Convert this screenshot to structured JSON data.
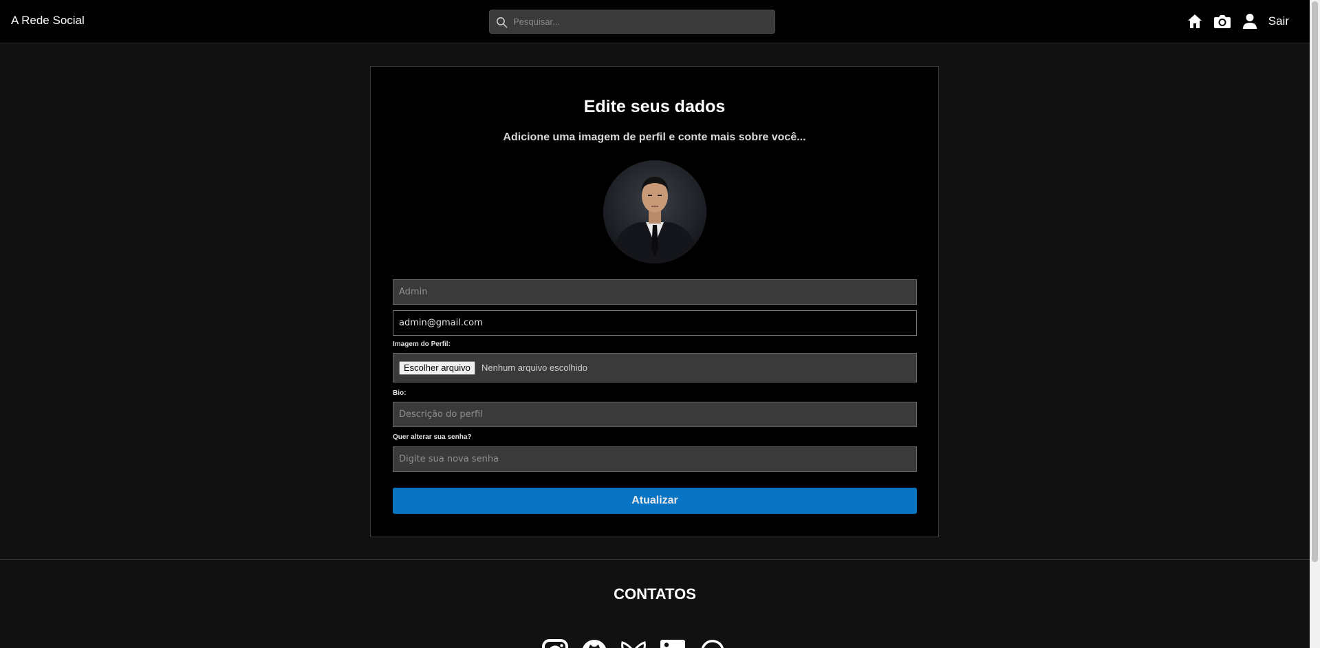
{
  "header": {
    "brand": "A Rede Social",
    "search_placeholder": "Pesquisar...",
    "icons": [
      "home-icon",
      "camera-icon",
      "user-icon"
    ],
    "logout_label": "Sair"
  },
  "form": {
    "title": "Edite seus dados",
    "subtitle": "Adicione uma imagem de perfil e conte mais sobre você...",
    "name_placeholder": "Admin",
    "email_value": "admin@gmail.com",
    "image_label": "Imagem do Perfil:",
    "file_button": "Escolher arquivo",
    "file_status": "Nenhum arquivo escolhido",
    "bio_label": "Bio:",
    "bio_placeholder": "Descrição do perfil",
    "password_label": "Quer alterar sua senha?",
    "password_placeholder": "Digite sua nova senha",
    "submit_label": "Atualizar"
  },
  "footer": {
    "title": "CONTATOS",
    "socials": [
      "instagram-icon",
      "github-icon",
      "bluesky-icon",
      "linkedin-icon",
      "whatsapp-icon"
    ]
  },
  "colors": {
    "accent": "#0a74c4",
    "header_bg": "#000000",
    "page_bg": "#111111"
  }
}
